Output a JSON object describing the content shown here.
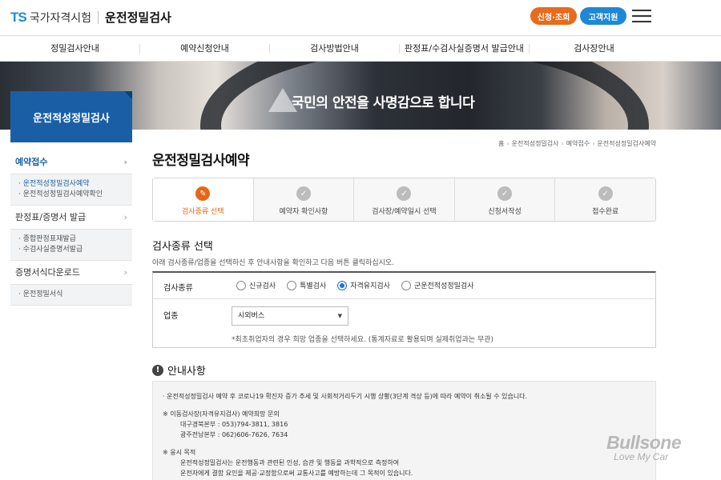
{
  "header": {
    "logo_ts": "TS",
    "logo_org": "국가자격시험",
    "logo_sub": "운전정밀검사",
    "btn_apply": "신청·조회",
    "btn_support": "고객지원"
  },
  "gnb": [
    "정밀검사안내",
    "예약신청안내",
    "검사방법안내",
    "판정표/수검사실증명서 발급안내",
    "검사장안내"
  ],
  "banner": {
    "text": "국민의 안전을 사명감으로 합니다"
  },
  "sidebar": {
    "title": "운전적성정밀검사",
    "groups": [
      {
        "label": "예약접수",
        "subs": [
          "· 운전적성정밀검사예약",
          "· 운전적성정밀검사예약확인"
        ]
      },
      {
        "label": "판정표/증명서 발급",
        "subs": [
          "· 종합판정표재발급",
          "· 수검사실증명서발급"
        ]
      },
      {
        "label": "증명서식다운로드",
        "subs": [
          "· 운전정밀서식"
        ]
      }
    ]
  },
  "breadcrumb": [
    "홈",
    "운전적성정밀검사",
    "예약접수",
    "운전적성정밀검사예약"
  ],
  "page_title": "운전정밀검사예약",
  "steps": [
    "검사종류 선택",
    "예약자 확인사항",
    "검사장/예약일시 선택",
    "신청서작성",
    "접수완료"
  ],
  "form": {
    "section_title": "검사종류 선택",
    "description": "아래 검사종류/업종을 선택하신 후 안내사항을 확인하고 다음 버튼 클릭하십시오.",
    "type_label": "검사종류",
    "options": [
      "신규검사",
      "특별검사",
      "자격유지검사",
      "군운전적성정밀검사"
    ],
    "selected_option": "자격유지검사",
    "industry_label": "업종",
    "industry_value": "시외버스",
    "note": "*최초취업자의 경우 희망 업종을 선택하세요. (통계자료로 활용되며 실제취업과는 무관)"
  },
  "guide": {
    "title": "안내사항",
    "lines": [
      "· 운전적성정밀검사 예약 후 코로나19 확진자 증가 추세 및 사회적거리두기 시행 상황(3단계 격상 등)에 따라 예약이 취소될 수 있습니다.",
      "※ 이동검사장(자격유지검사) 예약희망 문의",
      "대구경북본부 : 053)794-3811, 3816",
      "광주전남본부 : 062)606-7626, 7634",
      "※ 응시 목적",
      "운전적성정밀검사는 운전행동과 관련된 인성, 습관 및 행동을 과학적으로 측정하여",
      "운전자에게 결함 요인을 제공·교정함으로써 교통사고를 예방하는데 그 목적이 있습니다."
    ]
  },
  "watermark": {
    "brand": "Bullsone",
    "slogan": "Love My Car"
  }
}
